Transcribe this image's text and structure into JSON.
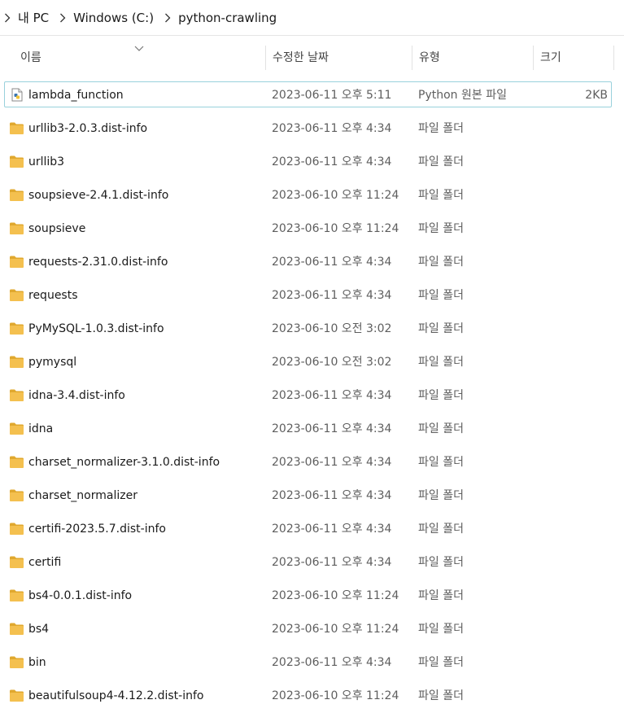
{
  "breadcrumb": {
    "items": [
      "내 PC",
      "Windows (C:)",
      "python-crawling"
    ]
  },
  "columns": {
    "name": "이름",
    "date": "수정한 날짜",
    "type": "유형",
    "size": "크기"
  },
  "colors": {
    "folder": "#f4c04f",
    "folder_dark": "#e0a82e",
    "selection_border": "#99d1dc"
  },
  "files": [
    {
      "name": "lambda_function",
      "date": "2023-06-11 오후 5:11",
      "type": "Python 원본 파일",
      "size": "2KB",
      "icon": "python-file-icon"
    },
    {
      "name": "urllib3-2.0.3.dist-info",
      "date": "2023-06-11 오후 4:34",
      "type": "파일 폴더",
      "size": "",
      "icon": "folder-icon"
    },
    {
      "name": "urllib3",
      "date": "2023-06-11 오후 4:34",
      "type": "파일 폴더",
      "size": "",
      "icon": "folder-icon"
    },
    {
      "name": "soupsieve-2.4.1.dist-info",
      "date": "2023-06-10 오후 11:24",
      "type": "파일 폴더",
      "size": "",
      "icon": "folder-icon"
    },
    {
      "name": "soupsieve",
      "date": "2023-06-10 오후 11:24",
      "type": "파일 폴더",
      "size": "",
      "icon": "folder-icon"
    },
    {
      "name": "requests-2.31.0.dist-info",
      "date": "2023-06-11 오후 4:34",
      "type": "파일 폴더",
      "size": "",
      "icon": "folder-icon"
    },
    {
      "name": "requests",
      "date": "2023-06-11 오후 4:34",
      "type": "파일 폴더",
      "size": "",
      "icon": "folder-icon"
    },
    {
      "name": "PyMySQL-1.0.3.dist-info",
      "date": "2023-06-10 오전 3:02",
      "type": "파일 폴더",
      "size": "",
      "icon": "folder-icon"
    },
    {
      "name": "pymysql",
      "date": "2023-06-10 오전 3:02",
      "type": "파일 폴더",
      "size": "",
      "icon": "folder-icon"
    },
    {
      "name": "idna-3.4.dist-info",
      "date": "2023-06-11 오후 4:34",
      "type": "파일 폴더",
      "size": "",
      "icon": "folder-icon"
    },
    {
      "name": "idna",
      "date": "2023-06-11 오후 4:34",
      "type": "파일 폴더",
      "size": "",
      "icon": "folder-icon"
    },
    {
      "name": "charset_normalizer-3.1.0.dist-info",
      "date": "2023-06-11 오후 4:34",
      "type": "파일 폴더",
      "size": "",
      "icon": "folder-icon"
    },
    {
      "name": "charset_normalizer",
      "date": "2023-06-11 오후 4:34",
      "type": "파일 폴더",
      "size": "",
      "icon": "folder-icon"
    },
    {
      "name": "certifi-2023.5.7.dist-info",
      "date": "2023-06-11 오후 4:34",
      "type": "파일 폴더",
      "size": "",
      "icon": "folder-icon"
    },
    {
      "name": "certifi",
      "date": "2023-06-11 오후 4:34",
      "type": "파일 폴더",
      "size": "",
      "icon": "folder-icon"
    },
    {
      "name": "bs4-0.0.1.dist-info",
      "date": "2023-06-10 오후 11:24",
      "type": "파일 폴더",
      "size": "",
      "icon": "folder-icon"
    },
    {
      "name": "bs4",
      "date": "2023-06-10 오후 11:24",
      "type": "파일 폴더",
      "size": "",
      "icon": "folder-icon"
    },
    {
      "name": "bin",
      "date": "2023-06-11 오후 4:34",
      "type": "파일 폴더",
      "size": "",
      "icon": "folder-icon"
    },
    {
      "name": "beautifulsoup4-4.12.2.dist-info",
      "date": "2023-06-10 오후 11:24",
      "type": "파일 폴더",
      "size": "",
      "icon": "folder-icon"
    }
  ]
}
